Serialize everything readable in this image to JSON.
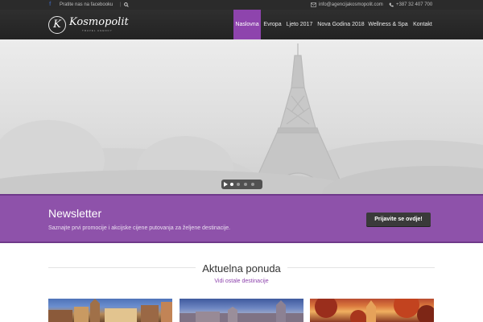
{
  "topbar": {
    "facebook_icon": "facebook-icon",
    "facebook_text": "Pratite nas na facebooku",
    "search_icon": "search-icon",
    "email": "info@agencijakosmopolit.com",
    "phone": "+387 32 407 700"
  },
  "logo": {
    "mark": "K",
    "name": "Kosmopolit",
    "tagline": "TRAVEL AGENCY"
  },
  "nav": {
    "items": [
      {
        "label": "Naslovna",
        "active": true
      },
      {
        "label": "Evropa",
        "active": false
      },
      {
        "label": "Ljeto 2017",
        "active": false
      },
      {
        "label": "Nova Godina 2018",
        "active": false
      },
      {
        "label": "Wellness & Spa",
        "active": false
      },
      {
        "label": "Kontakt",
        "active": false
      }
    ]
  },
  "slider": {
    "slide_count": 4,
    "current_slide": 1
  },
  "newsletter": {
    "title": "Newsletter",
    "description": "Saznajte prvi promocije i akcijske cijene putovanja za željene destinacije.",
    "button": "Prijavite se ovdje!"
  },
  "offers": {
    "title": "Aktuelna ponuda",
    "link": "Vidi ostale destinacije"
  },
  "colors": {
    "accent": "#8e44ad",
    "newsletter_bg": "#8e52aa",
    "header_bg": "#2b2b2b"
  }
}
